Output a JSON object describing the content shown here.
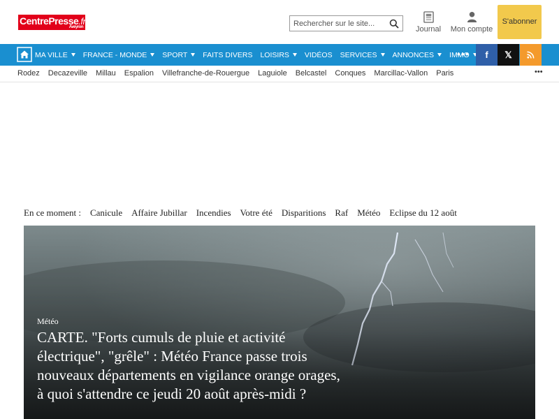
{
  "header": {
    "logo": {
      "main": "CentrePresse",
      "suffix": ".fr",
      "region": "Aveyron"
    },
    "search": {
      "placeholder": "Rechercher sur le site...",
      "icon": "search-icon"
    },
    "journal_label": "Journal",
    "account_label": "Mon compte",
    "subscribe_label": "S'abonner"
  },
  "nav": {
    "items": [
      {
        "label": "MA VILLE",
        "dropdown": true
      },
      {
        "label": "FRANCE - MONDE",
        "dropdown": true
      },
      {
        "label": "SPORT",
        "dropdown": true
      },
      {
        "label": "FAITS DIVERS",
        "dropdown": false
      },
      {
        "label": "LOISIRS",
        "dropdown": true
      },
      {
        "label": "VIDÉOS",
        "dropdown": false
      },
      {
        "label": "SERVICES",
        "dropdown": true
      },
      {
        "label": "ANNONCES",
        "dropdown": true
      },
      {
        "label": "IMMO",
        "dropdown": true
      }
    ],
    "more": "•••",
    "social": {
      "facebook": "f",
      "x": "𝕏",
      "rss": "rss-icon"
    },
    "colors": {
      "bar": "#1a8fd0",
      "facebook": "#2f5fa8",
      "x": "#111111",
      "rss": "#f49a2c"
    }
  },
  "cities": {
    "items": [
      "Rodez",
      "Decazeville",
      "Millau",
      "Espalion",
      "Villefranche-de-Rouergue",
      "Laguiole",
      "Belcastel",
      "Conques",
      "Marcillac-Vallon",
      "Paris"
    ],
    "more": "•••"
  },
  "trending": {
    "label": "En ce moment :",
    "items": [
      "Canicule",
      "Affaire Jubillar",
      "Incendies",
      "Votre été",
      "Disparitions",
      "Raf",
      "Météo",
      "Eclipse du 12 août"
    ]
  },
  "hero": {
    "category": "Météo",
    "title": "CARTE. \"Forts cumuls de pluie et activité électrique\", \"grêle\" : Météo France passe trois nouveaux départements en vigilance orange orages, à quoi s'attendre ce jeudi 20 août après-midi ?"
  },
  "colors": {
    "brand": "#e2001a",
    "subscribe": "#f2c94c"
  }
}
